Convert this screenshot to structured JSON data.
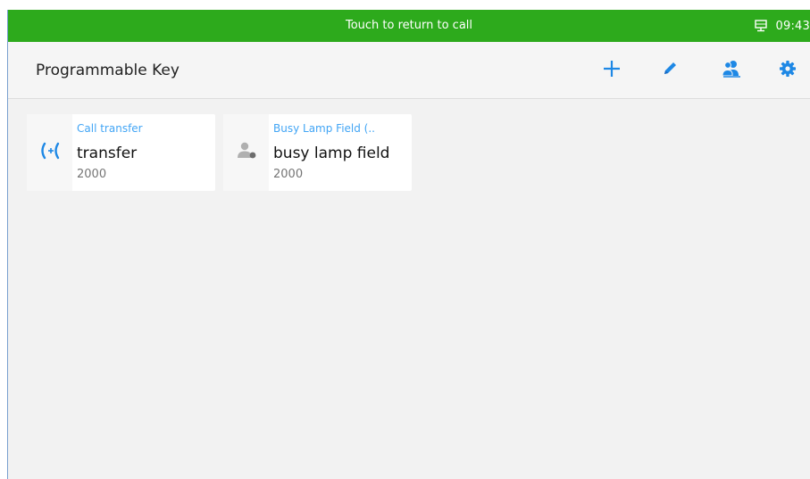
{
  "status_bar": {
    "call_banner": "Touch to return to call",
    "network_icon": "network-monitor-icon",
    "time": "09:43",
    "bar_color": "#2daa1c"
  },
  "app_bar": {
    "title": "Programmable Key",
    "actions": [
      {
        "icon": "add-icon"
      },
      {
        "icon": "edit-pencil-icon"
      },
      {
        "icon": "contacts-icon"
      },
      {
        "icon": "settings-gear-icon"
      }
    ],
    "accent_color": "#1e88e5"
  },
  "keys": [
    {
      "type": "Call transfer",
      "name": "transfer",
      "account": "2000",
      "icon": "call-transfer-icon"
    },
    {
      "type": "Busy Lamp Field (..",
      "name": "busy lamp field",
      "account": "2000",
      "icon": "busy-lamp-field-icon"
    }
  ]
}
